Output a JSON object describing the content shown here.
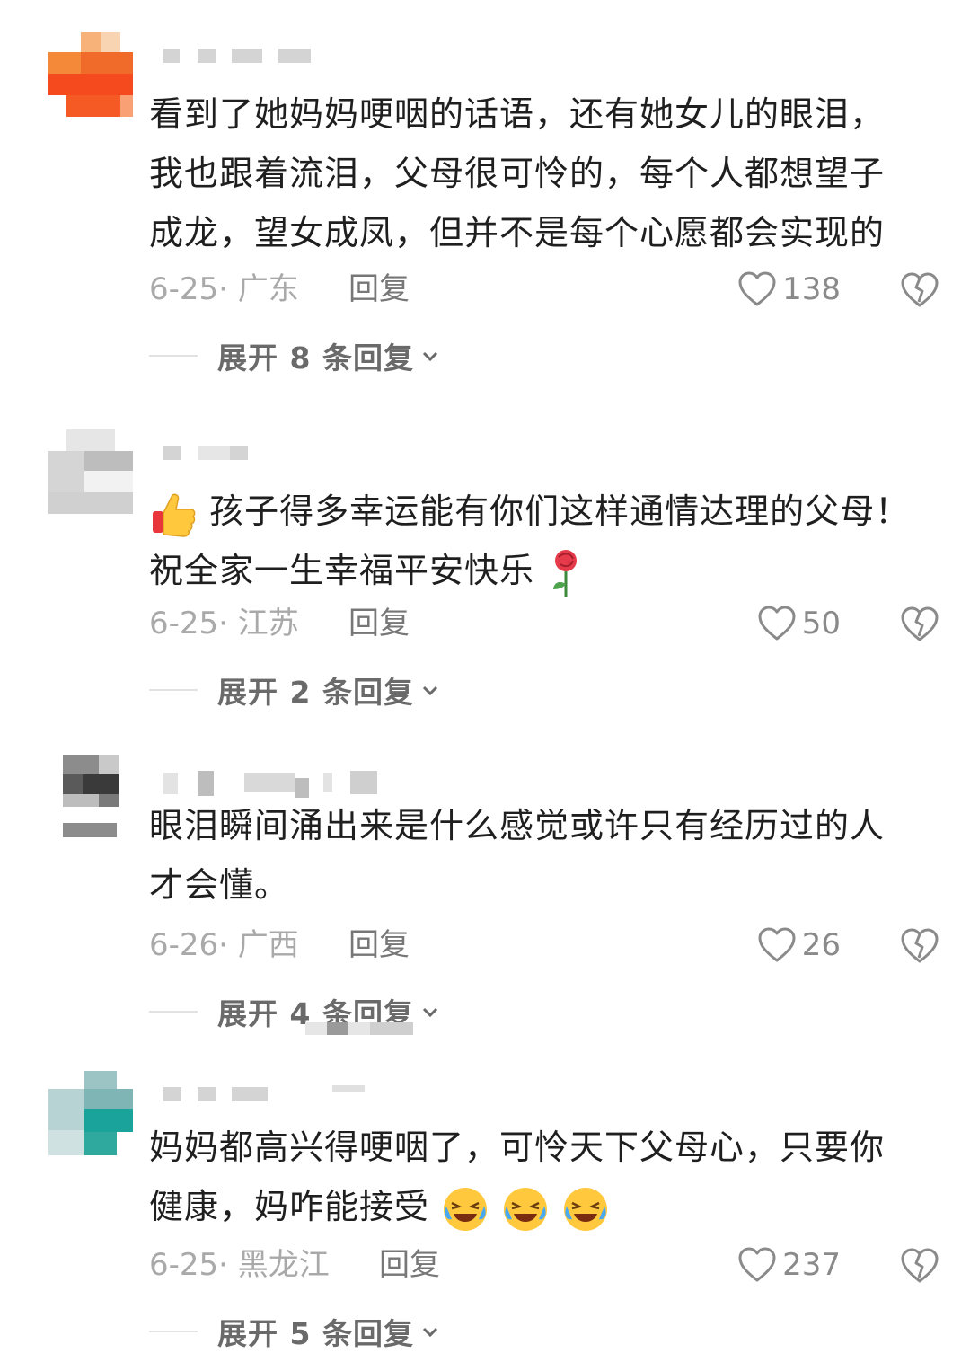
{
  "comments": [
    {
      "lines": [
        "看到了她妈妈哽咽的话语，还有她女儿的眼泪，",
        "我也跟着流泪，父母很可怜的，每个人都想望子",
        "成龙，望女成凤，但并不是每个心愿都会实现的"
      ],
      "date_location": "6-25· 广东",
      "reply_label": "回复",
      "likes": "138",
      "expand_label": "展开 8 条回复",
      "avatar_colors": [
        "#f5893a",
        "#f06a2a",
        "#f44a1e",
        "#f7b27a"
      ]
    },
    {
      "lines_with_emoji": {
        "emoji_start": "thumbs-up",
        "line1": "孩子得多幸运能有你们这样通情达理的父母！",
        "line2": "祝全家一生幸福平安快乐",
        "emoji_end": "rose"
      },
      "date_location": "6-25· 江苏",
      "reply_label": "回复",
      "likes": "50",
      "expand_label": "展开 2 条回复",
      "avatar_colors": [
        "#d9d9d9",
        "#bdbdbd",
        "#ececec",
        "#c9c9c9"
      ]
    },
    {
      "lines": [
        "眼泪瞬间涌出来是什么感觉或许只有经历过的人",
        "才会懂。"
      ],
      "date_location": "6-26· 广西",
      "reply_label": "回复",
      "likes": "26",
      "expand_label": "展开 4 条回复",
      "avatar_colors": [
        "#8c8c8c",
        "#3a3a3a",
        "#bdbdbd",
        "#5a5a5a"
      ]
    },
    {
      "lines": [
        "妈妈都高兴得哽咽了，可怜天下父母心，只要你",
        "健康，妈咋能接受"
      ],
      "line2_emoji": "crying-laughing x3",
      "date_location": "6-25· 黑龙江",
      "reply_label": "回复",
      "likes": "237",
      "expand_label": "展开 5 条回复",
      "avatar_colors": [
        "#7fb5b5",
        "#1aa39a",
        "#b7d3d3",
        "#2fa89e"
      ]
    }
  ],
  "icons": {
    "like": "heart-outline-icon",
    "dislike": "broken-heart-icon",
    "expand": "chevron-down-icon"
  },
  "colors": {
    "text": "#1f1f1f",
    "meta": "#a9a9a9",
    "expand": "#6a6a6a"
  }
}
